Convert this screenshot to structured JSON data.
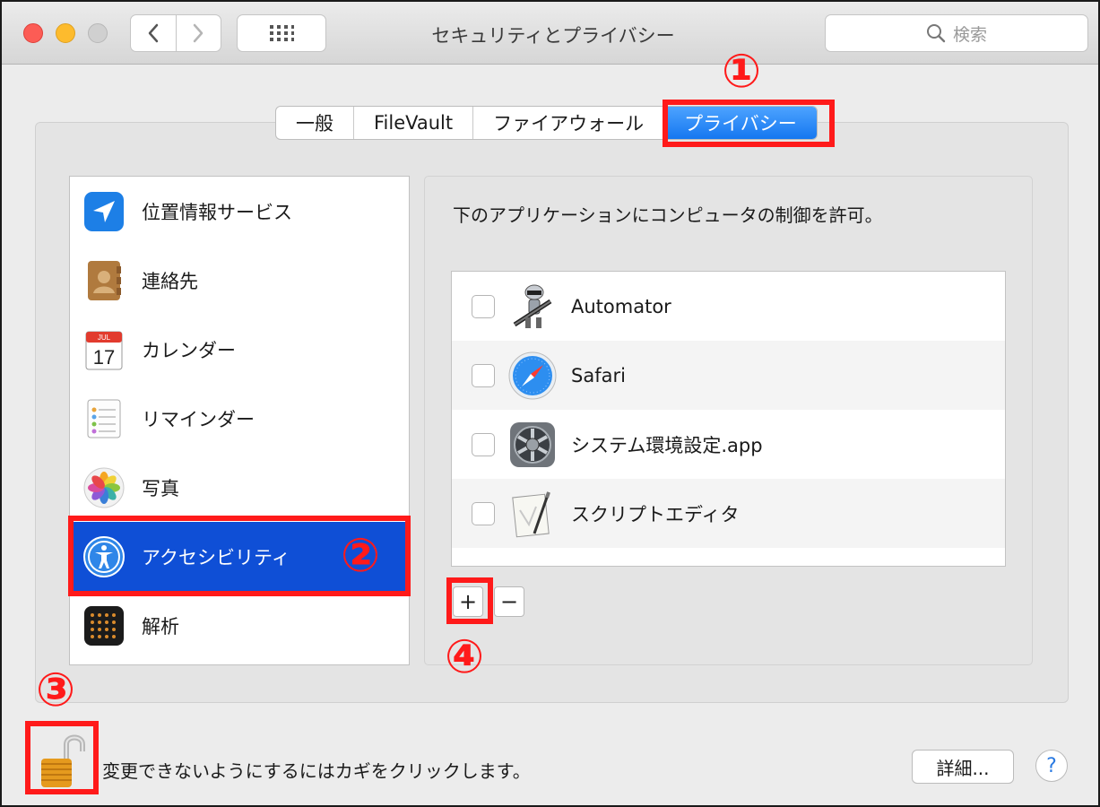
{
  "window": {
    "title": "セキュリティとプライバシー"
  },
  "search": {
    "placeholder": "検索"
  },
  "tabs": [
    {
      "label": "一般"
    },
    {
      "label": "FileVault"
    },
    {
      "label": "ファイアウォール"
    },
    {
      "label": "プライバシー",
      "selected": true
    }
  ],
  "sidebar": {
    "items": [
      {
        "label": "位置情報サービス",
        "icon": "location-icon"
      },
      {
        "label": "連絡先",
        "icon": "contacts-icon"
      },
      {
        "label": "カレンダー",
        "icon": "calendar-icon",
        "icon_month": "JUL",
        "icon_day": "17"
      },
      {
        "label": "リマインダー",
        "icon": "reminders-icon"
      },
      {
        "label": "写真",
        "icon": "photos-icon"
      },
      {
        "label": "アクセシビリティ",
        "icon": "accessibility-icon",
        "selected": true
      },
      {
        "label": "解析",
        "icon": "analytics-icon"
      }
    ]
  },
  "content": {
    "description": "下のアプリケーションにコンピュータの制御を許可。",
    "apps": [
      {
        "name": "Automator",
        "checked": false,
        "icon": "automator-icon"
      },
      {
        "name": "Safari",
        "checked": false,
        "icon": "safari-icon"
      },
      {
        "name": "システム環境設定.app",
        "checked": false,
        "icon": "system-preferences-icon"
      },
      {
        "name": "スクリプトエディタ",
        "checked": false,
        "icon": "script-editor-icon"
      }
    ],
    "add_label": "+",
    "remove_label": "−"
  },
  "footer": {
    "lock_text": "変更できないようにするにはカギをクリックします。",
    "detail_label": "詳細...",
    "help_label": "?"
  },
  "annotations": [
    {
      "number": "①"
    },
    {
      "number": "②"
    },
    {
      "number": "③"
    },
    {
      "number": "④"
    }
  ],
  "colors": {
    "accent": "#1577f0",
    "selection": "#0f4fd6",
    "annotation": "#ff1a1a"
  }
}
